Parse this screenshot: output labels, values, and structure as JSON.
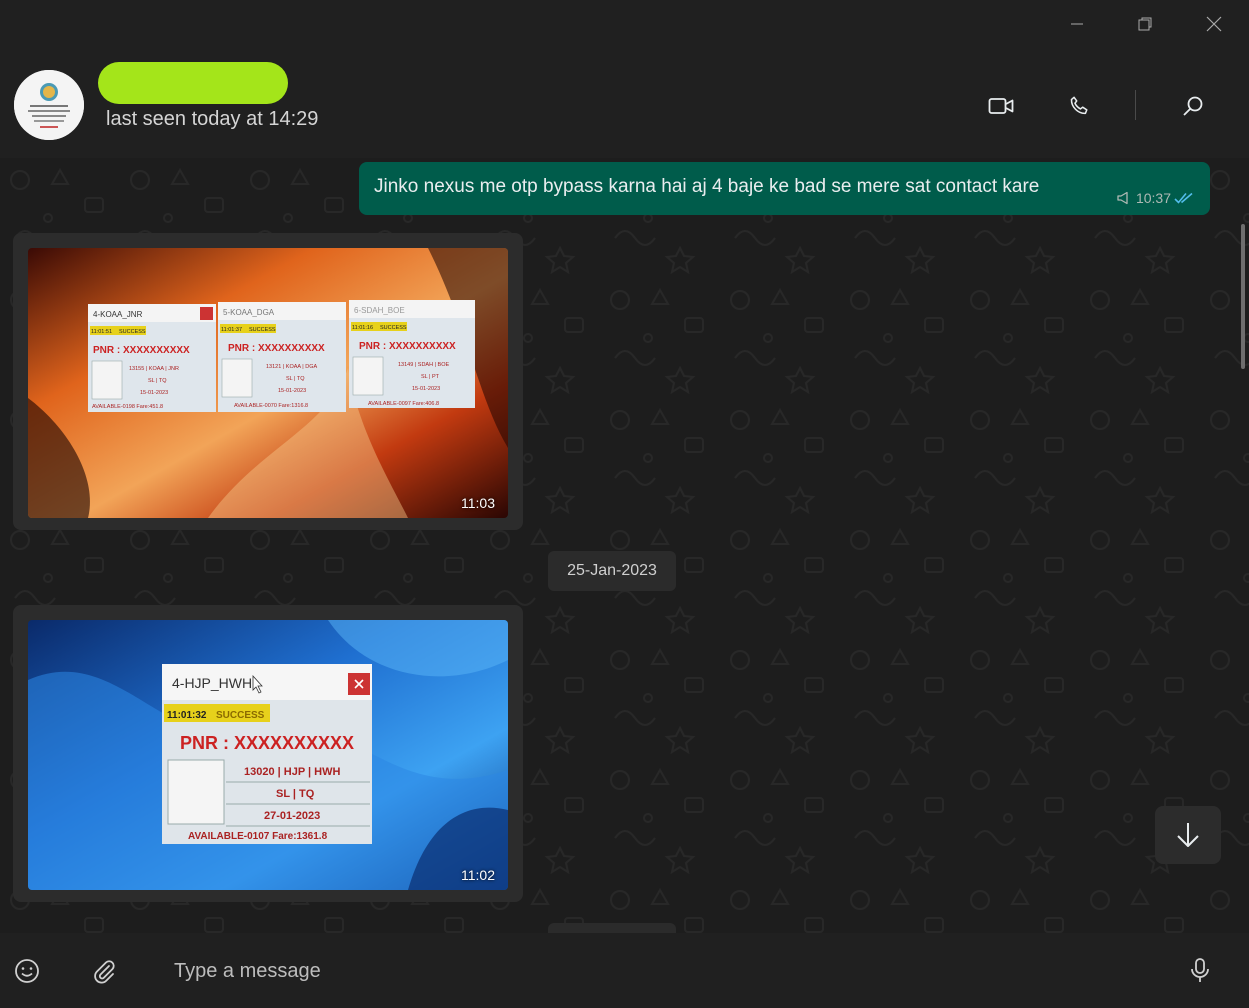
{
  "window": {
    "controls": {
      "minimize_icon": "minimize-icon",
      "restore_icon": "restore-icon",
      "close_icon": "close-icon"
    }
  },
  "header": {
    "contact_name_redacted": true,
    "last_seen": "last seen today at 14:29",
    "actions": [
      "video-call-icon",
      "voice-call-icon",
      "search-icon"
    ]
  },
  "messages": [
    {
      "direction": "outgoing",
      "type": "text",
      "text": "Jinko nexus me otp bypass karna hai aj 4 baje ke bad se mere sat contact kare",
      "time": "10:37",
      "status": "read"
    },
    {
      "direction": "incoming",
      "type": "image",
      "time": "11:03",
      "screens": [
        {
          "title": "4-KOAA_JNR",
          "clock": "11:01:51",
          "status": "SUCCESS",
          "pnr": "PNR : XXXXXXXXXX",
          "train": "13155 | KOAA | JNR",
          "class": "SL | TQ",
          "date": "15-01-2023",
          "avail": "AVAILABLE-0198 Fare:451.8"
        },
        {
          "title": "5-KOAA_DGA",
          "clock": "11:01:37",
          "status": "SUCCESS",
          "pnr": "PNR : XXXXXXXXXX",
          "train": "13121 | KOAA | DGA",
          "class": "SL | TQ",
          "date": "15-01-2023",
          "avail": "AVAILABLE-0070 Fare:1316.8"
        },
        {
          "title": "6-SDAH_BOE",
          "clock": "11:01:16",
          "status": "SUCCESS",
          "pnr": "PNR : XXXXXXXXXX",
          "train": "13149 | SDAH | BOE",
          "class": "SL | PT",
          "date": "15-01-2023",
          "avail": "AVAILABLE-0097 Fare:406.8"
        }
      ]
    },
    {
      "type": "date_separator",
      "label": "25-Jan-2023"
    },
    {
      "direction": "incoming",
      "type": "image",
      "time": "11:02",
      "screens": [
        {
          "title": "4-HJP_HWH",
          "clock": "11:01:32",
          "status": "SUCCESS",
          "pnr": "PNR : XXXXXXXXXX",
          "train": "13020 | HJP | HWH",
          "class": "SL | TQ",
          "date": "27-01-2023",
          "avail": "AVAILABLE-0107 Fare:1361.8"
        }
      ]
    }
  ],
  "composer": {
    "placeholder": "Type a message",
    "icons": [
      "emoji-icon",
      "attach-icon",
      "microphone-icon"
    ]
  },
  "colors": {
    "outgoing_bubble": "#005c4b",
    "accent_read": "#53bdeb",
    "name_highlight": "#a4e51a"
  }
}
